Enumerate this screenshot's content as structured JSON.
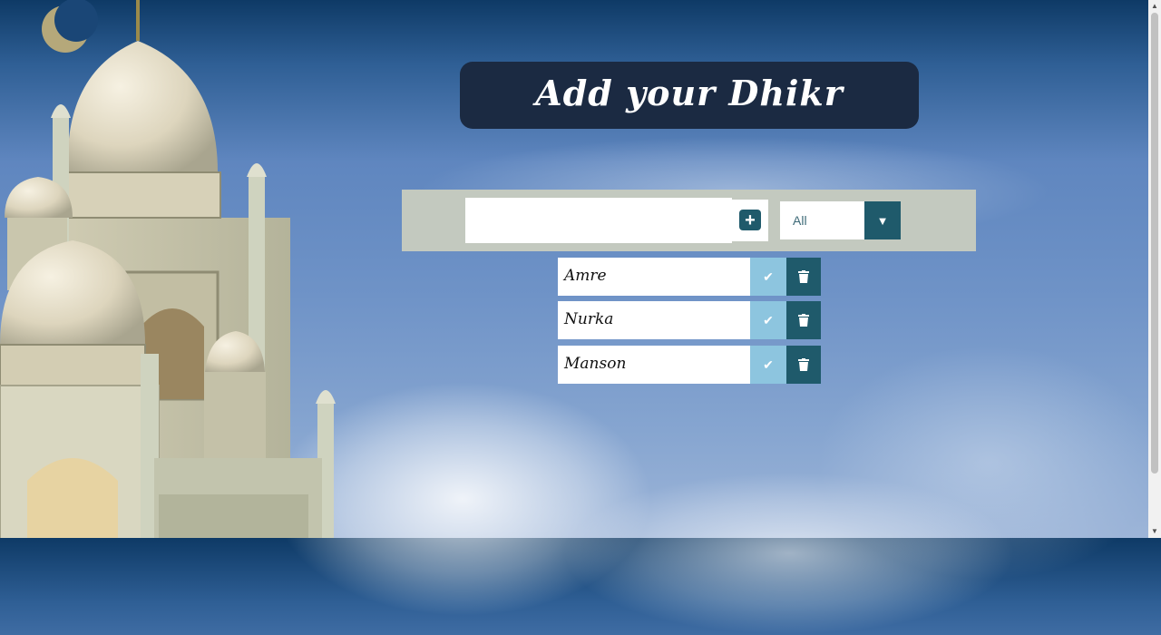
{
  "header": {
    "title": "Add your Dhikr"
  },
  "form": {
    "input_value": "",
    "add_icon": "plus-icon",
    "filter": {
      "selected": "All",
      "arrow": "▼"
    }
  },
  "todos": [
    {
      "label": "Amre"
    },
    {
      "label": "Nurka"
    },
    {
      "label": "Manson"
    }
  ],
  "colors": {
    "title_bg": "#1b2a42",
    "form_bar_bg": "#c3c9bf",
    "accent": "#1f5a6b",
    "check_bg": "#8dc5df",
    "sky_top": "#0e3a66",
    "sky_bottom": "#9db5d8"
  }
}
